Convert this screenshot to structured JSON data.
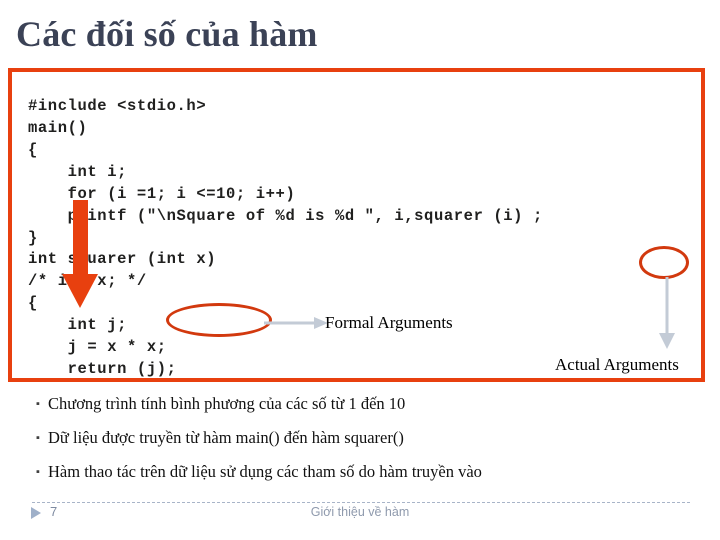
{
  "slide": {
    "title": "Các đối số của hàm",
    "page_number": "7",
    "footer_caption": "Giới thiệu về hàm"
  },
  "code_figure": {
    "border_color": "#e8400f",
    "top_block": "#include <stdio.h>\nmain()\n{\n    int i;\n    for (i =1; i <=10; i++)\n    printf (\"\\nSquare of %d is %d \", i,squarer (i) ;\n}",
    "bottom_block": "int squarer (int x)\n/* int x; */\n{\n    int j;\n    j = x * x;\n    return (j);\n}",
    "highlight_color": "#d2390e",
    "arrow_color": "#e8400f",
    "connector_color": "#c3cbd6"
  },
  "callouts": {
    "formal": "Formal Arguments",
    "actual": "Actual Arguments"
  },
  "bullets": {
    "marker": "▪",
    "items": [
      "Chương trình tính bình phương của các số từ 1 đến 10",
      "Dữ liệu được truyền từ hàm main() đến hàm squarer()",
      "Hàm thao tác trên dữ liệu sử dụng các tham số do hàm truyền vào"
    ]
  }
}
